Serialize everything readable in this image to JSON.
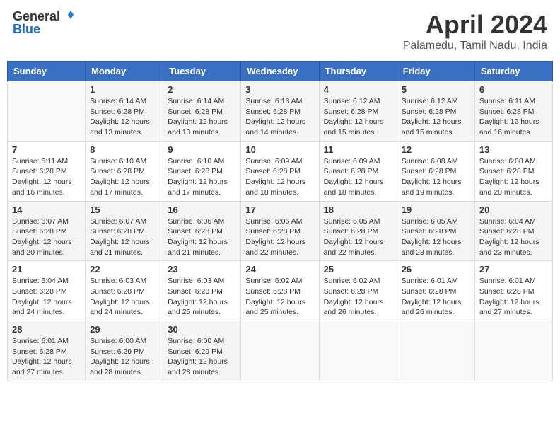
{
  "logo": {
    "general": "General",
    "blue": "Blue"
  },
  "title": {
    "month": "April 2024",
    "location": "Palamedu, Tamil Nadu, India"
  },
  "weekdays": [
    "Sunday",
    "Monday",
    "Tuesday",
    "Wednesday",
    "Thursday",
    "Friday",
    "Saturday"
  ],
  "weeks": [
    [
      {
        "day": "",
        "info": ""
      },
      {
        "day": "1",
        "info": "Sunrise: 6:14 AM\nSunset: 6:28 PM\nDaylight: 12 hours\nand 13 minutes."
      },
      {
        "day": "2",
        "info": "Sunrise: 6:14 AM\nSunset: 6:28 PM\nDaylight: 12 hours\nand 13 minutes."
      },
      {
        "day": "3",
        "info": "Sunrise: 6:13 AM\nSunset: 6:28 PM\nDaylight: 12 hours\nand 14 minutes."
      },
      {
        "day": "4",
        "info": "Sunrise: 6:12 AM\nSunset: 6:28 PM\nDaylight: 12 hours\nand 15 minutes."
      },
      {
        "day": "5",
        "info": "Sunrise: 6:12 AM\nSunset: 6:28 PM\nDaylight: 12 hours\nand 15 minutes."
      },
      {
        "day": "6",
        "info": "Sunrise: 6:11 AM\nSunset: 6:28 PM\nDaylight: 12 hours\nand 16 minutes."
      }
    ],
    [
      {
        "day": "7",
        "info": "Sunrise: 6:11 AM\nSunset: 6:28 PM\nDaylight: 12 hours\nand 16 minutes."
      },
      {
        "day": "8",
        "info": "Sunrise: 6:10 AM\nSunset: 6:28 PM\nDaylight: 12 hours\nand 17 minutes."
      },
      {
        "day": "9",
        "info": "Sunrise: 6:10 AM\nSunset: 6:28 PM\nDaylight: 12 hours\nand 17 minutes."
      },
      {
        "day": "10",
        "info": "Sunrise: 6:09 AM\nSunset: 6:28 PM\nDaylight: 12 hours\nand 18 minutes."
      },
      {
        "day": "11",
        "info": "Sunrise: 6:09 AM\nSunset: 6:28 PM\nDaylight: 12 hours\nand 18 minutes."
      },
      {
        "day": "12",
        "info": "Sunrise: 6:08 AM\nSunset: 6:28 PM\nDaylight: 12 hours\nand 19 minutes."
      },
      {
        "day": "13",
        "info": "Sunrise: 6:08 AM\nSunset: 6:28 PM\nDaylight: 12 hours\nand 20 minutes."
      }
    ],
    [
      {
        "day": "14",
        "info": "Sunrise: 6:07 AM\nSunset: 6:28 PM\nDaylight: 12 hours\nand 20 minutes."
      },
      {
        "day": "15",
        "info": "Sunrise: 6:07 AM\nSunset: 6:28 PM\nDaylight: 12 hours\nand 21 minutes."
      },
      {
        "day": "16",
        "info": "Sunrise: 6:06 AM\nSunset: 6:28 PM\nDaylight: 12 hours\nand 21 minutes."
      },
      {
        "day": "17",
        "info": "Sunrise: 6:06 AM\nSunset: 6:28 PM\nDaylight: 12 hours\nand 22 minutes."
      },
      {
        "day": "18",
        "info": "Sunrise: 6:05 AM\nSunset: 6:28 PM\nDaylight: 12 hours\nand 22 minutes."
      },
      {
        "day": "19",
        "info": "Sunrise: 6:05 AM\nSunset: 6:28 PM\nDaylight: 12 hours\nand 23 minutes."
      },
      {
        "day": "20",
        "info": "Sunrise: 6:04 AM\nSunset: 6:28 PM\nDaylight: 12 hours\nand 23 minutes."
      }
    ],
    [
      {
        "day": "21",
        "info": "Sunrise: 6:04 AM\nSunset: 6:28 PM\nDaylight: 12 hours\nand 24 minutes."
      },
      {
        "day": "22",
        "info": "Sunrise: 6:03 AM\nSunset: 6:28 PM\nDaylight: 12 hours\nand 24 minutes."
      },
      {
        "day": "23",
        "info": "Sunrise: 6:03 AM\nSunset: 6:28 PM\nDaylight: 12 hours\nand 25 minutes."
      },
      {
        "day": "24",
        "info": "Sunrise: 6:02 AM\nSunset: 6:28 PM\nDaylight: 12 hours\nand 25 minutes."
      },
      {
        "day": "25",
        "info": "Sunrise: 6:02 AM\nSunset: 6:28 PM\nDaylight: 12 hours\nand 26 minutes."
      },
      {
        "day": "26",
        "info": "Sunrise: 6:01 AM\nSunset: 6:28 PM\nDaylight: 12 hours\nand 26 minutes."
      },
      {
        "day": "27",
        "info": "Sunrise: 6:01 AM\nSunset: 6:28 PM\nDaylight: 12 hours\nand 27 minutes."
      }
    ],
    [
      {
        "day": "28",
        "info": "Sunrise: 6:01 AM\nSunset: 6:28 PM\nDaylight: 12 hours\nand 27 minutes."
      },
      {
        "day": "29",
        "info": "Sunrise: 6:00 AM\nSunset: 6:29 PM\nDaylight: 12 hours\nand 28 minutes."
      },
      {
        "day": "30",
        "info": "Sunrise: 6:00 AM\nSunset: 6:29 PM\nDaylight: 12 hours\nand 28 minutes."
      },
      {
        "day": "",
        "info": ""
      },
      {
        "day": "",
        "info": ""
      },
      {
        "day": "",
        "info": ""
      },
      {
        "day": "",
        "info": ""
      }
    ]
  ]
}
